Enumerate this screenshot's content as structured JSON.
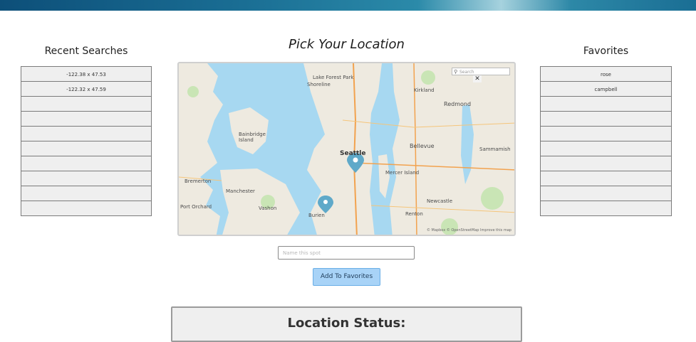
{
  "recent": {
    "title": "Recent Searches",
    "items": [
      "-122.38 x 47.53",
      "-122.32 x 47.59",
      "",
      "",
      "",
      "",
      "",
      "",
      "",
      ""
    ]
  },
  "center": {
    "title": "Pick Your Location"
  },
  "map": {
    "search_placeholder": "Search",
    "close_glyph": "✕",
    "attribution": "© Mapbox © OpenStreetMap Improve this map",
    "labels": {
      "lake_forest_park": "Lake Forest Park",
      "shoreline": "Shoreline",
      "kirkland": "Kirkland",
      "redmond": "Redmond",
      "bellevue": "Bellevue",
      "seattle": "Seattle",
      "bainbridge": "Bainbridge Island",
      "bremerton": "Bremerton",
      "port_orchard": "Port Orchard",
      "sammamish": "Sammamish",
      "newcastle": "Newcastle",
      "renton": "Renton",
      "burien": "Burien",
      "mercer_island": "Mercer Island",
      "vashon": "Vashon",
      "manchester": "Manchester"
    }
  },
  "favorites": {
    "title": "Favorites",
    "items": [
      "rose",
      "campbell",
      "",
      "",
      "",
      "",
      "",
      "",
      "",
      ""
    ]
  },
  "spot_input": {
    "placeholder": "Name this spot",
    "value": ""
  },
  "add_button": {
    "label": "Add To Favorites"
  },
  "status": {
    "title": "Location Status:"
  },
  "colors": {
    "water": "#a7d8f1",
    "land": "#eeeae0",
    "park": "#c9e5b5",
    "marker": "#5fa9c9",
    "button_bg": "#a8d3f7"
  }
}
